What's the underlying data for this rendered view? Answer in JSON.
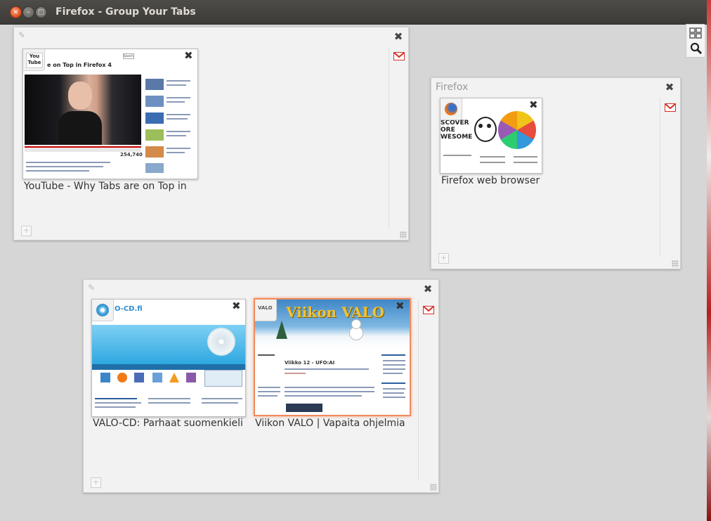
{
  "window": {
    "title": "Firefox - Group Your Tabs",
    "close_glyph": "×",
    "min_glyph": "–",
    "max_glyph": "□"
  },
  "toolbar": {
    "view_icon": "tab-view-icon",
    "search_icon": "search-icon"
  },
  "groups": [
    {
      "title": "",
      "tabs": [
        {
          "label": "YouTube - Why Tabs are on Top in",
          "favicon_text": "You Tube",
          "thumb_heading": "e on Top in Firefox 4",
          "search_label": "Search"
        }
      ]
    },
    {
      "title": "Firefox",
      "tabs": [
        {
          "label": "Firefox web browser",
          "thumb_text_1": "SCOVER",
          "thumb_text_2": "ORE",
          "thumb_text_3": "WESOME"
        }
      ]
    },
    {
      "title": "",
      "tabs": [
        {
          "label": "VALO-CD: Parhaat suomenkieli",
          "thumb_logo": "O-CD.fi"
        },
        {
          "label": "Viikon VALO | Vapaita ohjelmia",
          "thumb_logo": "VALO",
          "thumb_banner": "Viikon VALO",
          "thumb_subhead": "Viikko 12 - UFO:AI"
        }
      ]
    }
  ],
  "colors": {
    "accent": "#f08a5d",
    "titlebar": "#3c3b37",
    "gmail_red": "#d93025"
  }
}
